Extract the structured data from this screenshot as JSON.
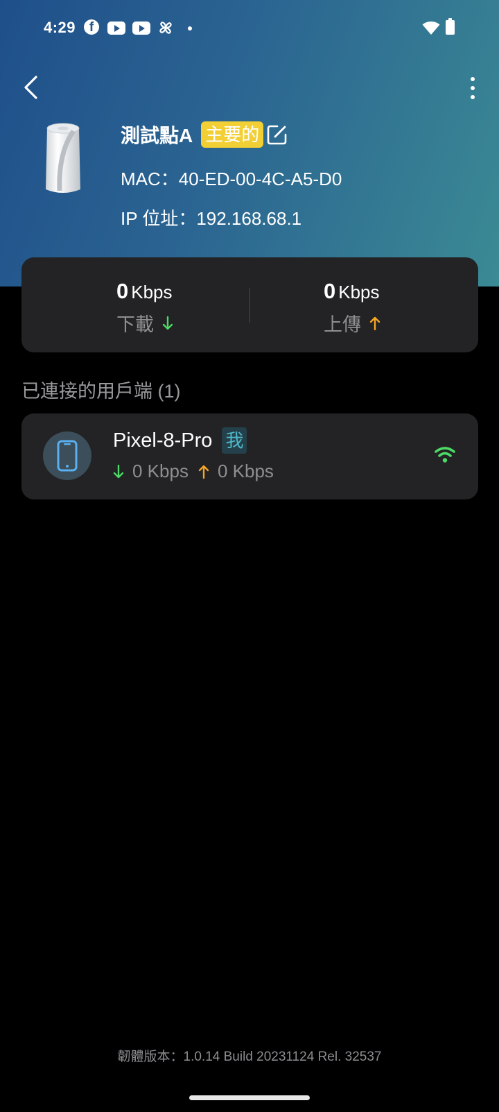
{
  "status_bar": {
    "time": "4:29",
    "icons": [
      "facebook-icon",
      "youtube-icon",
      "youtube-icon",
      "pinwheel-icon",
      "notification-dot-icon",
      "wifi-icon",
      "battery-icon"
    ]
  },
  "toolbar": {
    "back_icon": "chevron-left-icon",
    "more_icon": "more-vertical-icon"
  },
  "device": {
    "name": "測試點A",
    "primary_badge": "主要的",
    "mac": "MAC：40-ED-00-4C-A5-D0",
    "ip": "IP 位址：192.168.68.1",
    "edit_icon": "edit-icon"
  },
  "speed": {
    "download_value": "0",
    "download_unit": "Kbps",
    "download_label": "下載",
    "upload_value": "0",
    "upload_unit": "Kbps",
    "upload_label": "上傳"
  },
  "clients_section": {
    "title": "已連接的用戶端 (1)"
  },
  "clients": [
    {
      "name": "Pixel-8-Pro",
      "badge": "我",
      "download": "0 Kbps",
      "upload": "0 Kbps",
      "icon": "smartphone-icon",
      "signal_icon": "wifi-signal-icon"
    }
  ],
  "footer": {
    "firmware": "韌體版本：1.0.14 Build 20231124 Rel. 32537"
  },
  "colors": {
    "header_gradient_start": "#1f4f8a",
    "header_gradient_end": "#3b8a94",
    "primary_badge": "#f2cf34",
    "download_arrow": "#4cd964",
    "upload_arrow": "#f5a623",
    "card_background": "#232325",
    "wifi_signal": "#4cd964"
  }
}
